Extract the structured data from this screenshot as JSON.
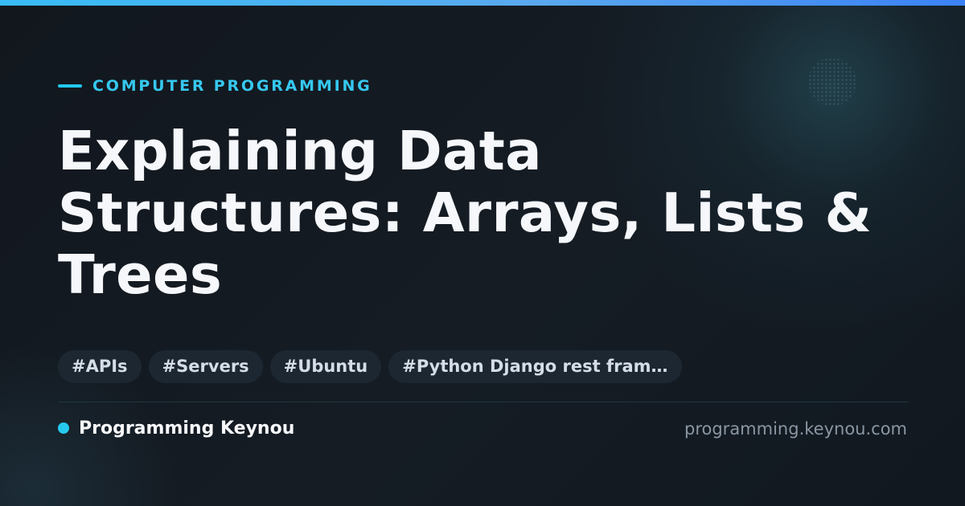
{
  "accent_colors": {
    "cyan": "#22c7ee",
    "top_bar_start": "#38bdf8",
    "top_bar_end": "#3b82f6"
  },
  "header": {
    "category": "COMPUTER PROGRAMMING",
    "title": "Explaining Data Structures: Arrays, Lists & Trees"
  },
  "tags": [
    "#APIs",
    "#Servers",
    "#Ubuntu",
    "#Python Django rest fram…"
  ],
  "footer": {
    "brand_name": "Programming Keynou",
    "site_url": "programming.keynou.com"
  },
  "icons": {
    "category_marker": "horizontal-line",
    "brand_marker": "dot",
    "decoration": "dot-pattern"
  }
}
